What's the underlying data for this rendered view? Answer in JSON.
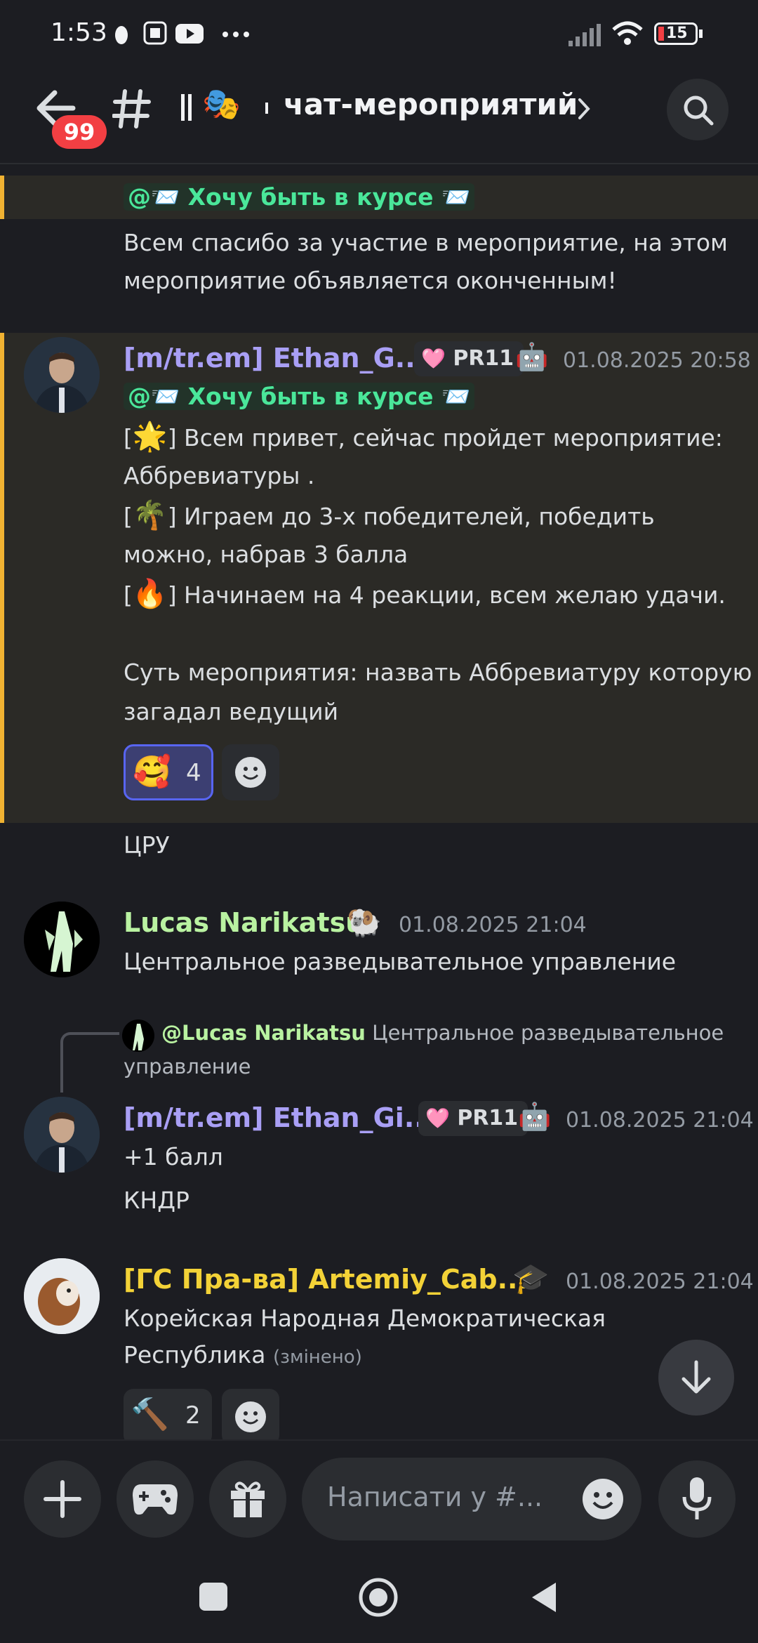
{
  "status_bar": {
    "time": "1:53",
    "battery": "15"
  },
  "header": {
    "back_badge": "99",
    "channel_name": "чат-мероприятий"
  },
  "messages": {
    "m0": {
      "mention": "@📨 Хочу быть в курсе 📨",
      "line1": "Всем спасибо за участие в мероприятие, на этом",
      "line2": "мероприятие объявляется оконченным!"
    },
    "m1": {
      "author": "[m/tr.em] Ethan_G...",
      "role_tag": "PR11",
      "time": "01.08.2025 20:58",
      "mention": "@📨 Хочу быть в курсе 📨",
      "l1a": "[",
      "l1e": "🌟",
      "l1b": "] Всем привет, сейчас пройдет мероприятие:",
      "l2": "Аббревиатуры .",
      "l3a": "[",
      "l3e": "🌴",
      "l3b": "] Играем до 3-х победителей, победить",
      "l4": "можно, набрав 3 балла",
      "l5a": "[",
      "l5e": "🔥",
      "l5b": "] Начинаем на 4 реакции, всем желаю удачи.",
      "l6": "Суть мероприятия: назвать Аббревиатуру которую",
      "l7": "загадал ведущий",
      "reaction_emoji": "🥰",
      "reaction_count": "4"
    },
    "m1b": {
      "text": "ЦРУ"
    },
    "m2": {
      "author": "Lucas Narikatsu",
      "badge_emoji": "🐏",
      "time": "01.08.2025 21:04",
      "text": "Центральное разведывательное управление"
    },
    "m3": {
      "reply_author": "@Lucas Narikatsu",
      "reply_text1": "Центральное разведывательное",
      "reply_text2": "управление",
      "author": "[m/tr.em] Ethan_Gi...",
      "role_tag": "PR11",
      "time": "01.08.2025 21:04",
      "text1": "+1 балл",
      "text2": "КНДР"
    },
    "m4": {
      "author": "[ГС Пра-ва] Artemiy_Cab...",
      "badge_emoji": "🎓",
      "time": "01.08.2025 21:04",
      "text1": "Корейская Народная Демократическая",
      "text2": "Республика",
      "edited": "(змінено)",
      "reaction_emoji": "🔨",
      "reaction_count": "2"
    }
  },
  "composer": {
    "placeholder": "Написати у #..."
  },
  "colors": {
    "background": "#1c1d22",
    "highlight": "#2b2a26",
    "highlight_bar": "#f0b232",
    "mention_text": "#4ae79a",
    "author_purple": "#a99ff5",
    "author_green": "#b9f2a1",
    "author_yellow": "#f3d237",
    "badge_red": "#f23f43"
  },
  "icons": [
    "back-arrow-icon",
    "hash-icon",
    "search-icon",
    "chevron-right-icon",
    "plus-icon",
    "gamepad-icon",
    "gift-icon",
    "emoji-icon",
    "mic-icon",
    "arrow-down-icon",
    "add-reaction-icon"
  ]
}
